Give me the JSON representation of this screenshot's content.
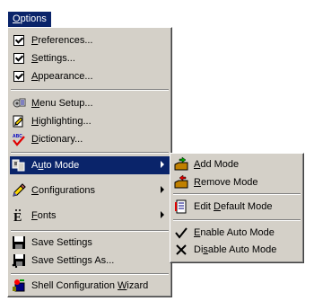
{
  "menubar": {
    "title": "Options",
    "title_underline": "O",
    "title_rest": "ptions"
  },
  "menu": {
    "items": [
      {
        "u": "P",
        "rest": "references...",
        "icon": "checkbox-icon"
      },
      {
        "u": "S",
        "rest": "ettings...",
        "icon": "checkbox-icon"
      },
      {
        "u": "A",
        "rest": "ppearance...",
        "icon": "checkbox-icon"
      },
      {
        "u": "M",
        "rest": "enu Setup...",
        "icon": "menu-setup-icon"
      },
      {
        "u": "H",
        "rest": "ighlighting...",
        "icon": "highlighting-icon"
      },
      {
        "u": "D",
        "rest": "ictionary...",
        "icon": "spellcheck-icon"
      },
      {
        "pre": "A",
        "u": "u",
        "rest": "to Mode",
        "icon": "auto-mode-icon"
      },
      {
        "u": "C",
        "rest": "onfigurations",
        "icon": "pencil-icon"
      },
      {
        "u": "F",
        "rest": "onts",
        "icon": "font-icon"
      },
      {
        "pre": "Save Settings",
        "icon": "floppy-icon"
      },
      {
        "pre": "Save Settings As...",
        "icon": "floppy-as-icon"
      },
      {
        "pre": "Shell Configuration ",
        "u": "W",
        "rest": "izard",
        "icon": "wizard-icon"
      }
    ]
  },
  "submenu": {
    "items": [
      {
        "u": "A",
        "rest": "dd Mode",
        "icon": "add-mode-icon"
      },
      {
        "u": "R",
        "rest": "emove Mode",
        "icon": "remove-mode-icon"
      },
      {
        "pre": "Edit ",
        "u": "D",
        "rest": "efault Mode",
        "icon": "edit-document-icon"
      },
      {
        "u": "E",
        "rest": "nable Auto Mode",
        "icon": "check-icon"
      },
      {
        "pre": "Di",
        "u": "s",
        "rest": "able Auto Mode",
        "icon": "x-icon"
      }
    ]
  },
  "colors": {
    "highlight": "#0a246a",
    "menu_face": "#d4d0c8"
  }
}
